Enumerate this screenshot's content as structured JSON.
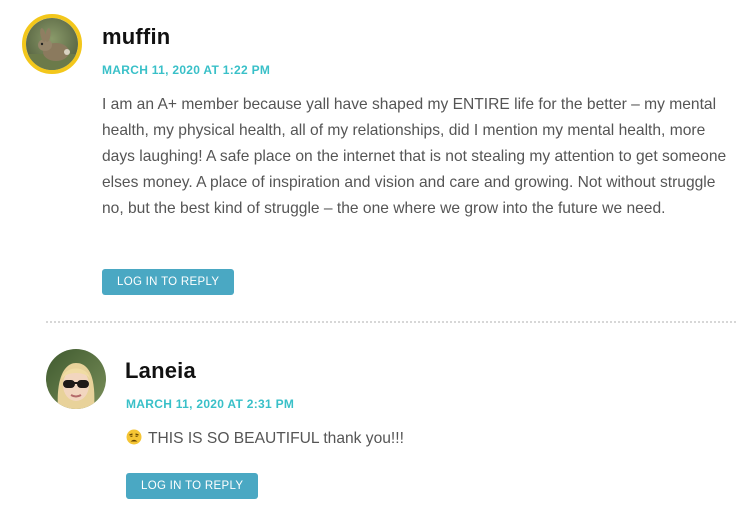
{
  "comments": [
    {
      "author": "muffin",
      "date": "MARCH 11, 2020 AT 1:22 PM",
      "avatar_icon": "rabbit-photo-avatar",
      "avatar_ring_color": "#f3c71b",
      "text": "I am an A+ member because yall have shaped my ENTIRE life for the better – my mental health, my physical health, all of my relationships, did I mention my mental health, more days laughing! A safe place on the internet that is not stealing my attention to get someone elses money. A place of inspiration and vision and care and growing. Not without struggle no, but the best kind of struggle – the one where we grow into the future we need.",
      "reply_label": "LOG IN TO REPLY"
    },
    {
      "author": "Laneia",
      "date": "MARCH 11, 2020 AT 2:31 PM",
      "avatar_icon": "woman-sunglasses-photo-avatar",
      "emoji_icon": "weary-face-emoji-icon",
      "text": "THIS IS SO BEAUTIFUL thank you!!!",
      "reply_label": "LOG IN TO REPLY"
    }
  ],
  "colors": {
    "accent": "#39c0c8",
    "button": "#4aa8c3",
    "author": "#111111",
    "body": "#555555"
  }
}
